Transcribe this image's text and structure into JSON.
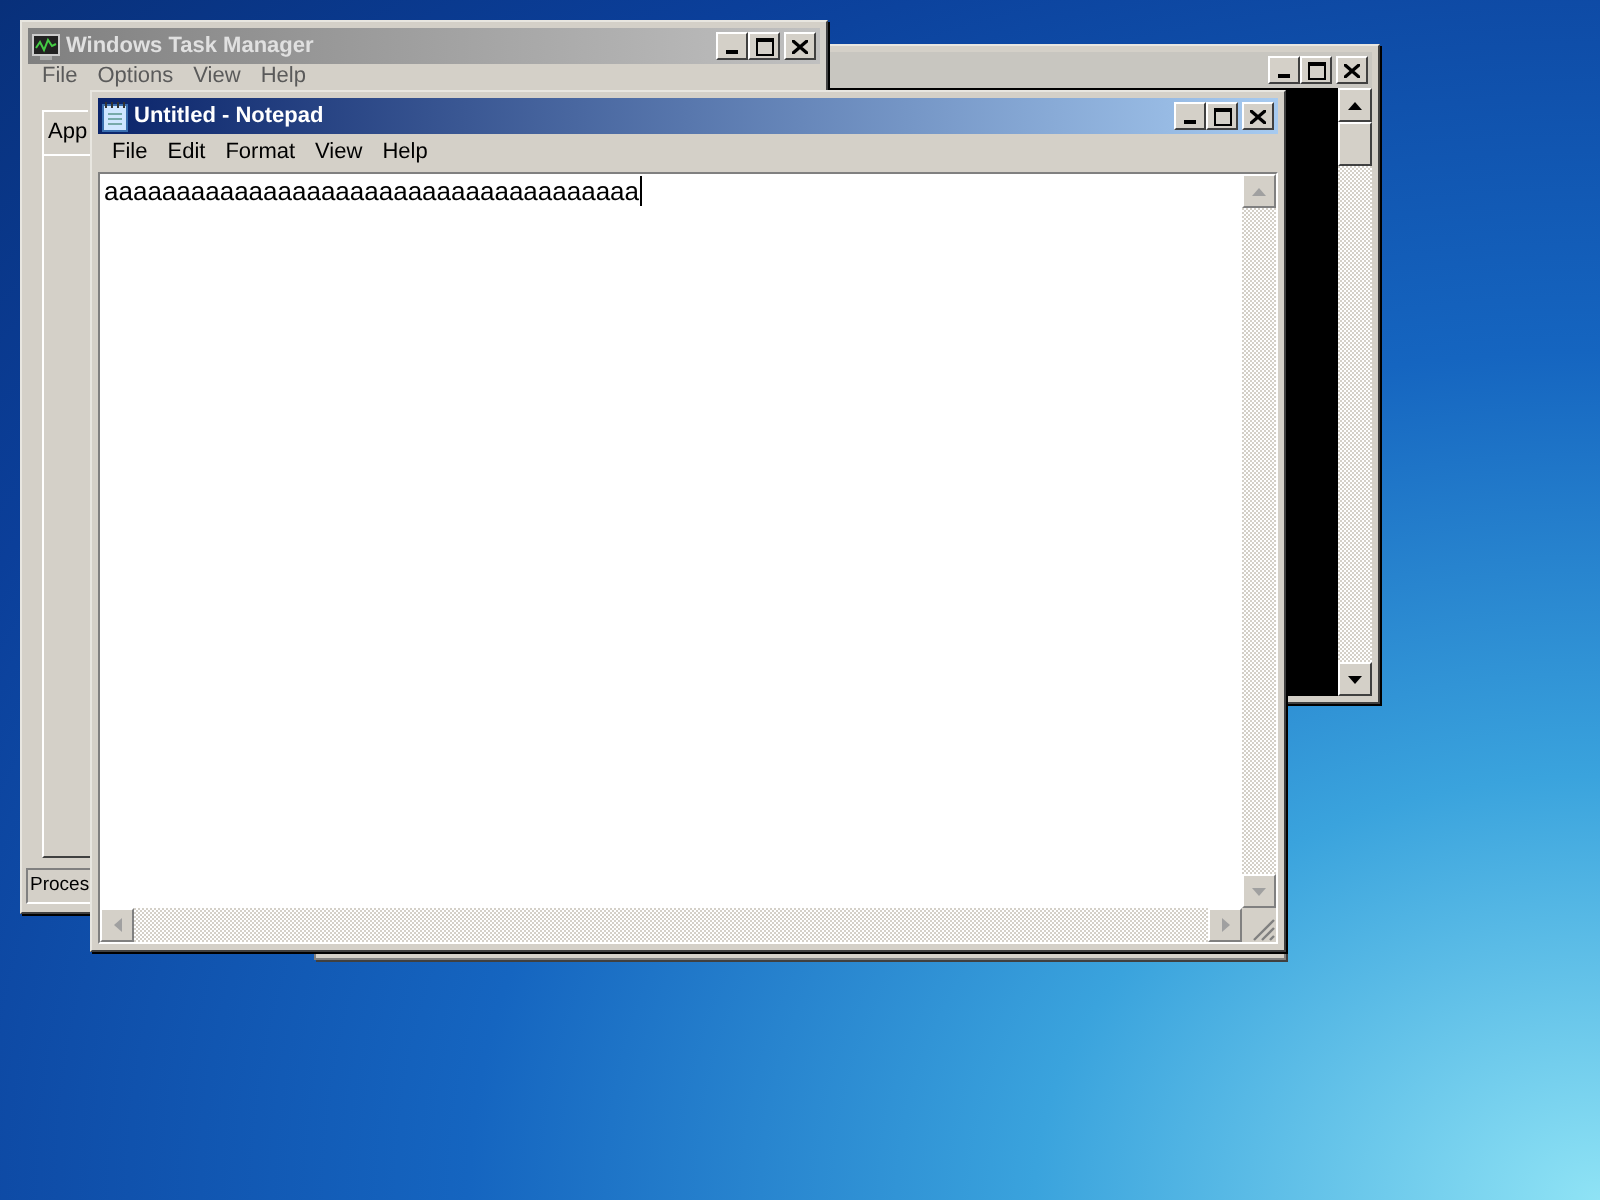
{
  "task_manager": {
    "title": "Windows Task Manager",
    "active": false,
    "menu": [
      "File",
      "Options",
      "View",
      "Help"
    ],
    "tab": "App",
    "status": "Proces"
  },
  "console": {
    "active": false
  },
  "notepad": {
    "title": "Untitled - Notepad",
    "active": true,
    "menu": [
      "File",
      "Edit",
      "Format",
      "View",
      "Help"
    ],
    "text": "aaaaaaaaaaaaaaaaaaaaaaaaaaaaaaaaaaaaa"
  }
}
